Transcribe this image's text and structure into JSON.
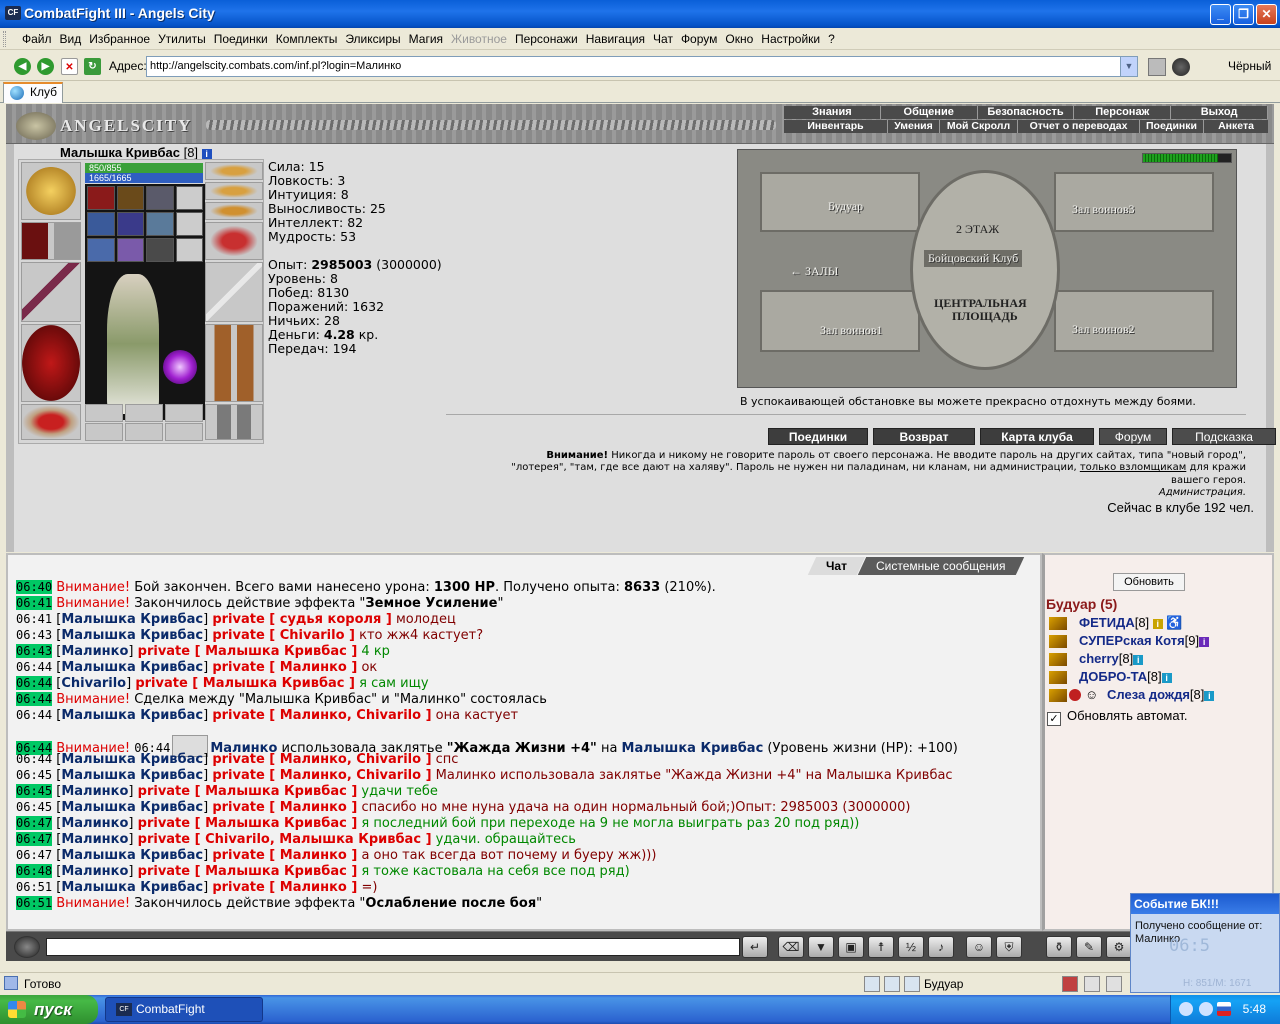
{
  "window": {
    "title": "CombatFight III - Angels City",
    "app_icon": "CF"
  },
  "menu": [
    "Файл",
    "Вид",
    "Избранное",
    "Утилиты",
    "Поединки",
    "Комплекты",
    "Эликсиры",
    "Магия",
    "Животное",
    "Персонажи",
    "Навигация",
    "Чат",
    "Форум",
    "Окно",
    "Настройки",
    "?"
  ],
  "menu_disabled": "Животное",
  "address": {
    "label": "Адрес:",
    "url": "http://angelscity.combats.com/inf.pl?login=Малинко",
    "theme": "Чёрный"
  },
  "tab": {
    "label": "Клуб"
  },
  "game": {
    "logo": "ANGELSCITY",
    "nav_top": [
      "Знания",
      "Общение",
      "Безопасность",
      "Персонаж",
      "Выход"
    ],
    "nav_bottom": [
      "Инвентарь",
      "Умения",
      "Мой Скролл",
      "Отчет о переводах",
      "Поединки",
      "Анкета"
    ]
  },
  "character": {
    "name": "Малышка Кривбас",
    "level": "[8]",
    "hp": "850/855",
    "mp": "1665/1665",
    "stats": [
      {
        "label": "Сила:",
        "value": "15"
      },
      {
        "label": "Ловкость:",
        "value": "3"
      },
      {
        "label": "Интуиция:",
        "value": "8"
      },
      {
        "label": "Выносливость:",
        "value": "25"
      },
      {
        "label": "Интеллект:",
        "value": "82"
      },
      {
        "label": "Мудрость:",
        "value": "53"
      }
    ],
    "exp_label": "Опыт:",
    "exp_value": "2985003",
    "exp_next": "(3000000)",
    "level_label": "Уровень:",
    "level_value": "8",
    "wins_label": "Побед:",
    "wins_value": "8130",
    "losses_label": "Поражений:",
    "losses_value": "1632",
    "draws_label": "Ничьих:",
    "draws_value": "28",
    "money_label": "Деньги:",
    "money_value": "4.28",
    "money_unit": "кр.",
    "transfers_label": "Передач:",
    "transfers_value": "194"
  },
  "map": {
    "rooms": [
      "Будуар",
      "Зал воинов3",
      "Зал воинов1",
      "Зал воинов2"
    ],
    "center": [
      "2 ЭТАЖ",
      "Бойцовский Клуб",
      "ЦЕНТРАЛЬНАЯ",
      "ПЛОЩАДЬ"
    ],
    "halls": "ЗАЛЫ",
    "caption": "В успокаивающей обстановке вы можете прекрасно отдохнуть между боями."
  },
  "actions": [
    "Поединки",
    "Возврат",
    "Карта клуба",
    "Форум",
    "Подсказка"
  ],
  "warning": {
    "bold": "Внимание!",
    "line1": " Никогда и никому не говорите пароль от своего персонажа. Не вводите пароль на других сайтах, типа \"новый город\",",
    "line2a": "\"лотерея\", \"там, где все дают на халяву\". Пароль не нужен ни паладинам, ни кланам, ни администрации, ",
    "line2link": "только взломщикам",
    "line2b": " для кражи",
    "line3": "вашего героя.",
    "admin": "Администрация."
  },
  "online": "Сейчас в клубе 192 чел.",
  "chat_tabs": [
    "Чат",
    "Системные сообщения"
  ],
  "chat": {
    "l1": {
      "t": "06:40",
      "a": "Внимание!",
      "b": " Бой закончен. Всего вами нанесено урона: ",
      "c": "1300 HP",
      "d": ". Получено опыта: ",
      "e": "8633",
      "f": " (210%)."
    },
    "l2": {
      "t": "06:41",
      "a": "Внимание!",
      "b": " Закончилось действие эффекта \"",
      "c": "Земное Усиление",
      "d": "\""
    },
    "l3": {
      "t": "06:41",
      "n": "Малышка Кривбас",
      "p": "private [ судья короля ]",
      "m": " молодец"
    },
    "l4": {
      "t": "06:43",
      "n": "Малышка Кривбас",
      "p": "private [ Chivarilo ]",
      "m": " кто жж4 кастует?"
    },
    "l5": {
      "t": "06:43",
      "n": "Малинко",
      "p": "private [ Малышка Кривбас ]",
      "m": " 4 кр"
    },
    "l6": {
      "t": "06:44",
      "n": "Малышка Кривбас",
      "p": "private [ Малинко ]",
      "m": " ок"
    },
    "l7": {
      "t": "06:44",
      "n": "Chivarilo",
      "p": "private [ Малышка Кривбас ]",
      "m": " я сам ищу"
    },
    "l8": {
      "t": "06:44",
      "a": "Внимание!",
      "b": " Сделка между \"Малышка Кривбас\" и \"Малинко\" состоялась"
    },
    "l9": {
      "t": "06:44",
      "n": "Малышка Кривбас",
      "p": "private [ Малинко, Chivarilo ]",
      "m": " она кастует"
    },
    "l10": {
      "t": "06:44",
      "a": "Внимание!",
      "t2": "06:44",
      "n": "Малинко",
      "b": " использовала заклятье ",
      "c": "\"Жажда Жизни +4\"",
      "d": " на ",
      "n2": "Малышка Кривбас",
      "e": " (Уровень жизни (HP): +100)"
    },
    "l11": {
      "t": "06:44",
      "n": "Малышка Кривбас",
      "p": "private [ Малинко, Chivarilo ]",
      "m": " спс"
    },
    "l12": {
      "t": "06:45",
      "n": "Малышка Кривбас",
      "p": "private [ Малинко, Chivarilo ]",
      "m": " Малинко использовала заклятье \"Жажда Жизни +4\" на Малышка Кривбас"
    },
    "l13": {
      "t": "06:45",
      "n": "Малинко",
      "p": "private [ Малышка Кривбас ]",
      "m": " удачи тебе"
    },
    "l14": {
      "t": "06:45",
      "n": "Малышка Кривбас",
      "p": "private [ Малинко ]",
      "m": " спасибо но мне нуна удача на один нормальный бой;)Опыт: 2985003 (3000000)"
    },
    "l15": {
      "t": "06:47",
      "n": "Малинко",
      "p": "private [ Малышка Кривбас ]",
      "m": " я последний бой при переходе на 9 не могла выиграть раз 20 под ряд))"
    },
    "l16": {
      "t": "06:47",
      "n": "Малинко",
      "p": "private [ Chivarilo, Малышка Кривбас ]",
      "m": " удачи. обращайтесь"
    },
    "l17": {
      "t": "06:47",
      "n": "Малышка Кривбас",
      "p": "private [ Малинко ]",
      "m": " а оно так всегда вот почему и буеру жж)))"
    },
    "l18": {
      "t": "06:48",
      "n": "Малинко",
      "p": "private [ Малышка Кривбас ]",
      "m": " я тоже кастовала на себя все под ряд)"
    },
    "l19": {
      "t": "06:51",
      "n": "Малышка Кривбас",
      "p": "private [ Малинко ]",
      "m": " =)"
    },
    "l20": {
      "t": "06:51",
      "a": "Внимание!",
      "b": " Закончилось действие эффекта \"",
      "c": "Ослабление после боя",
      "d": "\""
    }
  },
  "room_panel": {
    "refresh": "Обновить",
    "room": "Будуар (5)",
    "users": [
      {
        "name": "ФЕТИДА",
        "level": "[8]"
      },
      {
        "name": "СУПЕРская Котя",
        "level": "[9]"
      },
      {
        "name": "cherry",
        "level": "[8]"
      },
      {
        "name": "ДОБРО-ТА",
        "level": "[8]"
      },
      {
        "name": "Слеза дождя",
        "level": "[8]"
      }
    ],
    "auto": "Обновлять автомат."
  },
  "status": {
    "text": "Готово",
    "location": "Будуар"
  },
  "taskbar": {
    "start": "пуск",
    "item": "CombatFight",
    "clock": "5:48"
  },
  "notify": {
    "title": "Событие БК!!!",
    "line1": "Получено сообщение от:",
    "line2": "Малинко",
    "faded": "06:5",
    "hm": "Н: 851/М: 1671"
  },
  "colors": {
    "titlebar": "#0a5fd8",
    "chat_time_highlight": "#00c864",
    "private": "#dd0000",
    "nick": "#0a2a6a",
    "room_title": "#8b1a1a"
  }
}
